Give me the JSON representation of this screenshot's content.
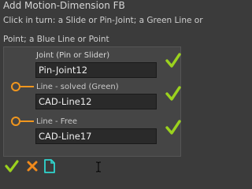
{
  "dialog": {
    "title": "Add Motion-Dimension FB",
    "instructions": [
      "Click in turn: a Slide or Pin-Joint; a Green Line or",
      "Point; a Blue Line or Point"
    ]
  },
  "rows": [
    {
      "label": "Joint (Pin or Slider)",
      "value": "Pin-Joint12",
      "label_color": "#d8d8d8"
    },
    {
      "label": "Line - solved (Green)",
      "value": "CAD-Line12",
      "label_color": "#c9c9c9"
    },
    {
      "label": "Line - Free",
      "value": "CAD-Line17",
      "label_color": "#c9c9c9"
    }
  ],
  "colors": {
    "check_green": "#9bd21e",
    "cross_orange": "#f08a1c",
    "pin_orange": "#f0961e",
    "doc_teal": "#2fd6cf"
  },
  "buttons": [
    "ok-check-icon",
    "cancel-x-icon",
    "new-document-icon"
  ]
}
